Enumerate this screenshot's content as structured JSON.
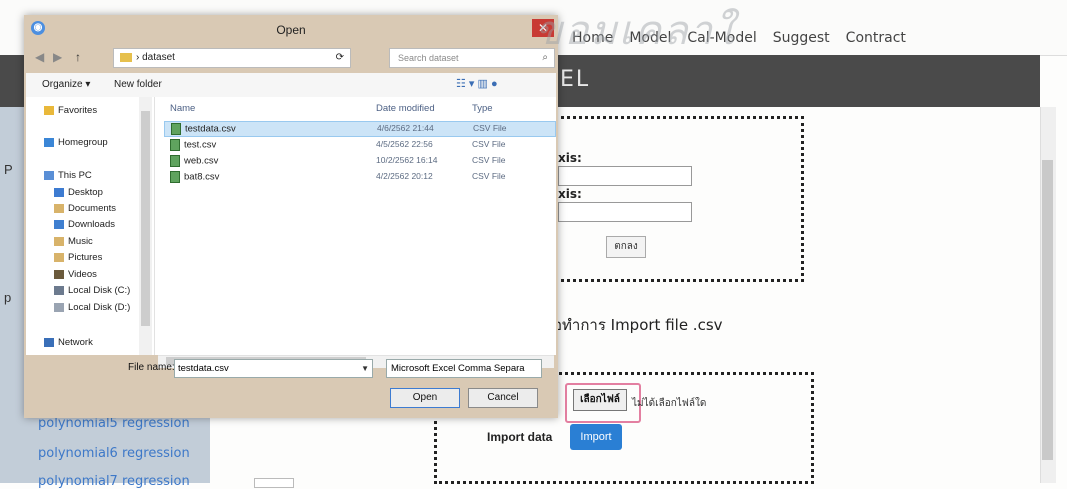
{
  "watermark": "ขอมเคลาใ",
  "site": {
    "nav": [
      "Home",
      "Model",
      "Cal-Model",
      "Suggest",
      "Contract"
    ],
    "banner_text": "EL",
    "sidebar_items": [
      "polynomial5 regression",
      "polynomial6 regression",
      "polynomial7 regression"
    ],
    "sidebar_letters": [
      "P",
      "p"
    ],
    "form": {
      "x_axis_label": "xis:",
      "y_axis_label": "xis:",
      "ok_button": "ตกลง",
      "import_title": "อทำการ Import file .csv",
      "choose_file": "เลือกไฟล์",
      "no_file": "ไม่ได้เลือกไฟล์ใด",
      "import_data_label": "Import data",
      "import_button": "Import"
    }
  },
  "dialog": {
    "title": "Open",
    "app_icon": "chrome-icon",
    "path": "dataset",
    "search_placeholder": "Search dataset",
    "organize_label": "Organize ▾",
    "new_folder_label": "New folder",
    "nav_items": [
      {
        "label": "Favorites",
        "icon": "star-icon",
        "color": "#e9b83a"
      },
      {
        "label": "Homegroup",
        "icon": "homegroup-icon",
        "color": "#3b86d6"
      },
      {
        "label": "This PC",
        "icon": "computer-icon",
        "color": "#5a8fd6"
      },
      {
        "label": "Desktop",
        "icon": "desktop-icon",
        "color": "#3d7bd1"
      },
      {
        "label": "Documents",
        "icon": "documents-icon",
        "color": "#d8b36a"
      },
      {
        "label": "Downloads",
        "icon": "downloads-icon",
        "color": "#3f7fd0"
      },
      {
        "label": "Music",
        "icon": "music-icon",
        "color": "#d8b36a"
      },
      {
        "label": "Pictures",
        "icon": "pictures-icon",
        "color": "#d8b36a"
      },
      {
        "label": "Videos",
        "icon": "videos-icon",
        "color": "#6b5a3c"
      },
      {
        "label": "Local Disk (C:)",
        "icon": "disk-icon",
        "color": "#6c7a8e"
      },
      {
        "label": "Local Disk (D:)",
        "icon": "disk-icon",
        "color": "#9aa4b2"
      },
      {
        "label": "Network",
        "icon": "network-icon",
        "color": "#3a6fb8"
      }
    ],
    "columns": [
      "Name",
      "Date modified",
      "Type"
    ],
    "files": [
      {
        "name": "testdata.csv",
        "date": "4/6/2562 21:44",
        "type": "CSV File",
        "selected": true
      },
      {
        "name": "test.csv",
        "date": "4/5/2562 22:56",
        "type": "CSV File",
        "selected": false
      },
      {
        "name": "web.csv",
        "date": "10/2/2562 16:14",
        "type": "CSV File",
        "selected": false
      },
      {
        "name": "bat8.csv",
        "date": "4/2/2562 20:12",
        "type": "CSV File",
        "selected": false
      }
    ],
    "file_name_label": "File name:",
    "file_name_value": "testdata.csv",
    "file_type_value": "Microsoft Excel Comma Separa",
    "open_button": "Open",
    "cancel_button": "Cancel"
  }
}
